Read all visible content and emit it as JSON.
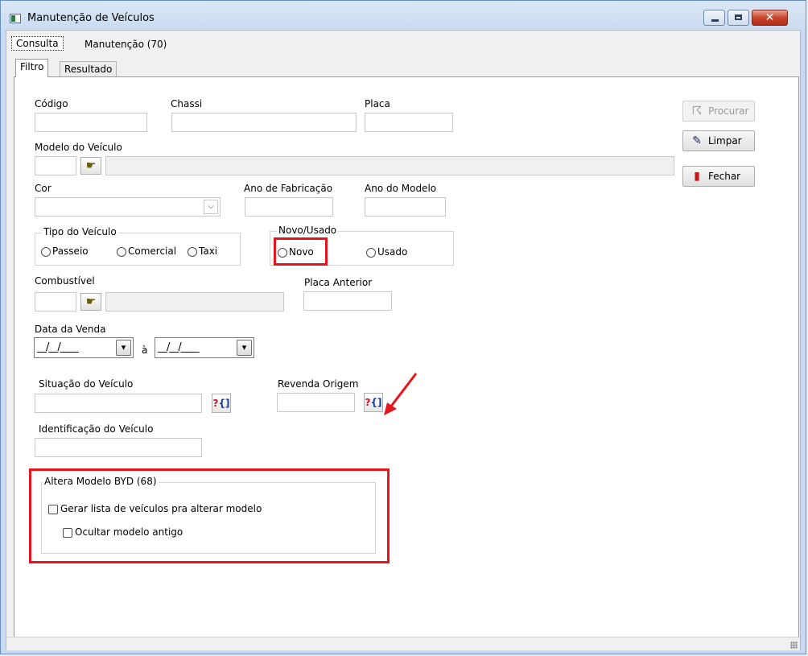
{
  "window": {
    "title": "Manutenção de Veículos",
    "close_glyph": "✕"
  },
  "outer_tabs": [
    "Consulta",
    "Manutenção (70)"
  ],
  "inner_tabs": [
    "Filtro",
    "Resultado"
  ],
  "fields": {
    "codigo": "Código",
    "chassi": "Chassi",
    "placa": "Placa",
    "modelo": "Modelo do Veículo",
    "cor": "Cor",
    "ano_fabricacao": "Ano de Fabricação",
    "ano_modelo": "Ano do Modelo",
    "combustivel": "Combustível",
    "placa_anterior": "Placa Anterior",
    "data_venda": "Data da Venda",
    "data_separator": "à",
    "date_mask": "__/__/____",
    "situacao": "Situação do Veículo",
    "revenda_origem": "Revenda Origem",
    "identificacao": "Identificação do Veículo"
  },
  "tipo_veiculo": {
    "title": "Tipo do Veículo",
    "options": [
      "Passeio",
      "Comercial",
      "Taxi"
    ]
  },
  "novo_usado": {
    "title": "Novo/Usado",
    "options": [
      "Novo",
      "Usado"
    ]
  },
  "altera_modelo": {
    "title": "Altera Modelo BYD (68)",
    "checkboxes": [
      "Gerar lista de veículos pra alterar modelo",
      "Ocultar modelo antigo"
    ]
  },
  "buttons": {
    "procurar": "Procurar",
    "limpar": "Limpar",
    "fechar": "Fechar"
  },
  "icons": {
    "combo_arrow": "⌵",
    "dropdown": "▾",
    "hand": "☛",
    "lookup_q": "?",
    "lookup_b": "{]",
    "procurar": "☈",
    "limpar": "✎",
    "fechar": "▮"
  },
  "colors": {
    "highlight": "#e8141c"
  }
}
